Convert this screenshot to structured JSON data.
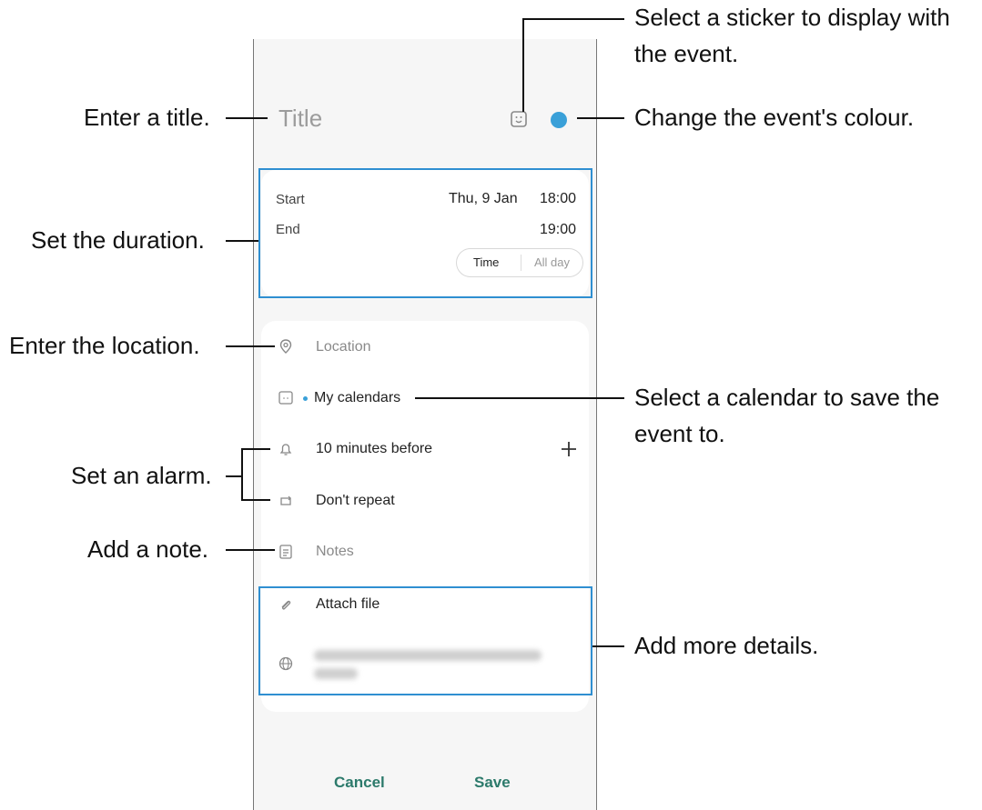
{
  "event": {
    "title_placeholder": "Title",
    "sticker_icon": "sticker-icon",
    "color_dot_color": "#3aa0d8"
  },
  "duration": {
    "start_label": "Start",
    "start_date": "Thu, 9 Jan",
    "start_time": "18:00",
    "end_label": "End",
    "end_time": "19:00",
    "toggle": {
      "time": "Time",
      "all_day": "All day",
      "selected": "Time"
    }
  },
  "details": {
    "location": "Location",
    "calendar": "My calendars",
    "alarm": "10 minutes before",
    "repeat": "Don't repeat",
    "notes": "Notes",
    "attach": "Attach file"
  },
  "footer": {
    "cancel": "Cancel",
    "save": "Save"
  },
  "callouts": {
    "sticker": "Select a sticker to display with",
    "sticker_2": "the event.",
    "title": "Enter a title.",
    "colour": "Change the event's colour.",
    "duration": "Set the duration.",
    "location": "Enter the location.",
    "calendar": "Select a calendar to save the",
    "calendar_2": "event to.",
    "alarm": "Set an alarm.",
    "note": "Add a note.",
    "more": "Add more details."
  },
  "colors": {
    "accent": "#2f8fd1",
    "button": "#2c7a6b"
  }
}
